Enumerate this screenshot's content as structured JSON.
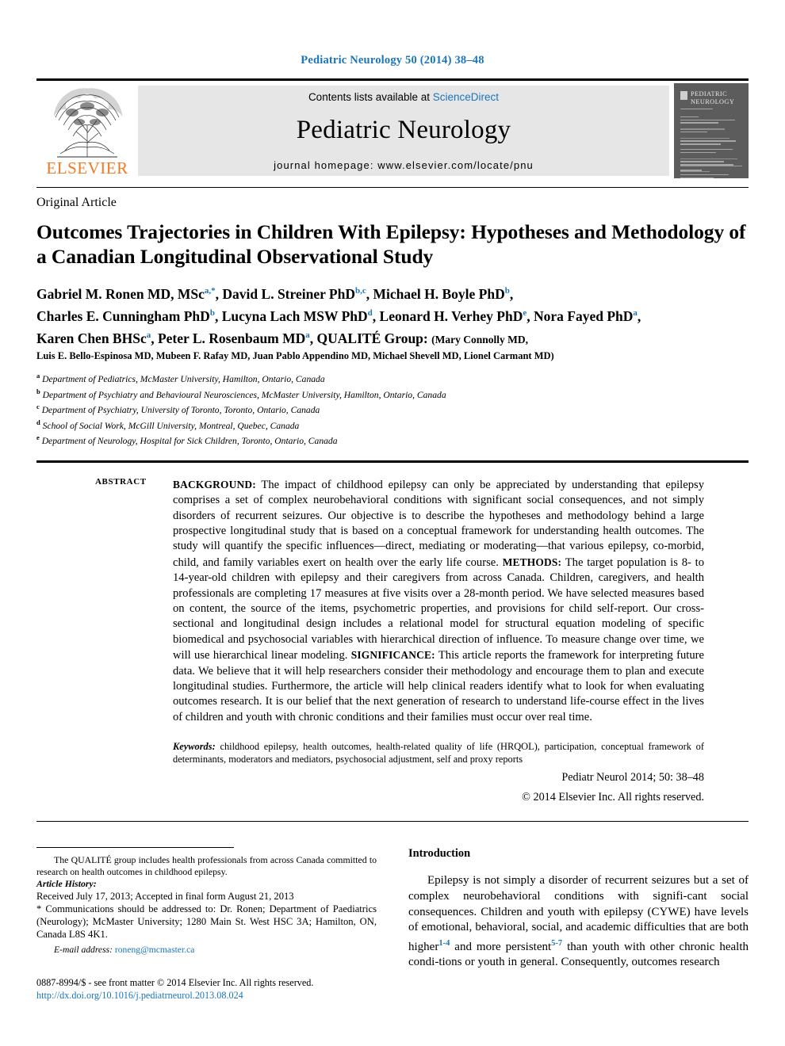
{
  "running_head": "Pediatric Neurology 50 (2014) 38–48",
  "banner": {
    "publisher_name": "ELSEVIER",
    "contents_prefix": "Contents lists available at ",
    "contents_link": "ScienceDirect",
    "journal_title": "Pediatric Neurology",
    "homepage": "journal homepage: www.elsevier.com/locate/pnu",
    "cover_title_line1": "PEDIATRIC",
    "cover_title_line2": "NEUROLOGY"
  },
  "article": {
    "type": "Original Article",
    "title": "Outcomes Trajectories in Children With Epilepsy: Hypotheses and Methodology of a Canadian Longitudinal Observational Study"
  },
  "authors": {
    "line1": "Gabriel M. Ronen MD, MSc",
    "line1_sup": "a,*",
    "line1b": ", David L. Streiner PhD",
    "line1b_sup": "b,c",
    "line1c": ", Michael H. Boyle PhD",
    "line1c_sup": "b",
    "line1d": ",",
    "line2": "Charles E. Cunningham PhD",
    "line2_sup": "b",
    "line2b": ", Lucyna Lach MSW PhD",
    "line2b_sup": "d",
    "line2c": ", Leonard H. Verhey PhD",
    "line2c_sup": "e",
    "line2d": ", Nora Fayed PhD",
    "line2d_sup": "a",
    "line2e": ",",
    "line3": "Karen Chen  BHSc",
    "line3_sup": "a",
    "line3b": ", Peter L. Rosenbaum MD",
    "line3b_sup": "a",
    "line3c": ", QUALITÉ Group:",
    "line3d": "(Mary Connolly MD,",
    "line4": "Luis E. Bello-Espinosa MD, Mubeen F. Rafay MD, Juan Pablo Appendino MD, Michael Shevell MD, Lionel Carmant MD)"
  },
  "affiliations": [
    {
      "mark": "a",
      "text": "Department of Pediatrics, McMaster University, Hamilton, Ontario, Canada"
    },
    {
      "mark": "b",
      "text": "Department of Psychiatry and Behavioural Neurosciences, McMaster University, Hamilton, Ontario, Canada"
    },
    {
      "mark": "c",
      "text": "Department of Psychiatry, University of Toronto, Toronto, Ontario, Canada"
    },
    {
      "mark": "d",
      "text": "School of Social Work, McGill University, Montreal, Quebec, Canada"
    },
    {
      "mark": "e",
      "text": "Department of Neurology, Hospital for Sick Children, Toronto, Ontario, Canada"
    }
  ],
  "abstract": {
    "label": "ABSTRACT",
    "background_label": "BACKGROUND:",
    "background_text": " The impact of childhood epilepsy can only be appreciated by understanding that epilepsy comprises a set of complex neurobehavioral conditions with significant social consequences, and not simply disorders of recurrent seizures. Our objective is to describe the hypotheses and methodology behind a large prospective longitudinal study that is based on a conceptual framework for understanding health outcomes. The study will quantify the specific influences—direct, mediating or moderating—that various epilepsy, co-morbid, child, and family variables exert on health over the early life course. ",
    "methods_label": "METHODS:",
    "methods_text": " The target population is 8- to 14-year-old children with epilepsy and their caregivers from across Canada. Children, caregivers, and health professionals are completing 17 measures at five visits over a 28-month period. We have selected measures based on content, the source of the items, psychometric properties, and provisions for child self-report. Our cross-sectional and longitudinal design includes a relational model for structural equation modeling of specific biomedical and psychosocial variables with hierarchical direction of influence. To measure change over time, we will use hierarchical linear modeling. ",
    "significance_label": "SIGNIFICANCE:",
    "significance_text": " This article reports the framework for interpreting future data. We believe that it will help researchers consider their methodology and encourage them to plan and execute longitudinal studies. Furthermore, the article will help clinical readers identify what to look for when evaluating outcomes research. It is our belief that the next generation of research to understand life-course effect in the lives of children and youth with chronic conditions and their families must occur over real time.",
    "keywords_label": "Keywords:",
    "keywords_text": " childhood epilepsy, health outcomes, health-related quality of life (HRQOL), participation, conceptual framework of determinants, moderators and mediators, psychosocial adjustment, self and proxy reports",
    "citation": "Pediatr Neurol 2014; 50: 38–48",
    "copyright": "© 2014 Elsevier Inc. All rights reserved."
  },
  "footnotes": {
    "group_note": "The QUALITÉ group includes health professionals from across Canada committed to research on health outcomes in childhood epilepsy.",
    "history_label": "Article History:",
    "history_text": "Received July 17, 2013; Accepted in final form August 21, 2013",
    "correspondence": "* Communications should be addressed to: Dr. Ronen; Department of Paediatrics (Neurology); McMaster University; 1280 Main St. West HSC 3A; Hamilton, ON, Canada L8S 4K1.",
    "email_label": "E-mail address:",
    "email": "roneng@mcmaster.ca"
  },
  "copyright_block": {
    "issn_line": "0887-8994/$ - see front matter © 2014 Elsevier Inc. All rights reserved.",
    "doi": "http://dx.doi.org/10.1016/j.pediatrneurol.2013.08.024"
  },
  "introduction": {
    "heading": "Introduction",
    "p1_a": "Epilepsy is not simply a disorder of recurrent seizures but a set of complex neurobehavioral conditions with signifi-cant social consequences. Children and youth with epilepsy (CYWE) have levels of emotional, behavioral, social, and academic difficulties that are both higher",
    "p1_ref1": "1-4",
    "p1_b": " and more persistent",
    "p1_ref2": "5-7",
    "p1_c": " than youth with other chronic health condi-tions or youth in general. Consequently, outcomes research"
  },
  "colors": {
    "link": "#1b75bb",
    "elsevier_orange": "#f47920",
    "banner_grey": "#e6e6e6",
    "cover_grey": "#5c5c5c"
  }
}
